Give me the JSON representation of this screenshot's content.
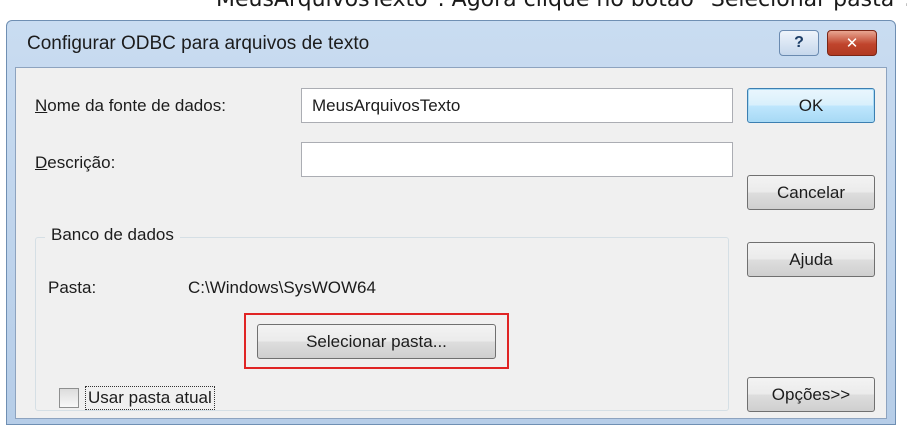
{
  "caption": {
    "text": "MeusArquivosTexto\". Agora clique no botão \"Selecionar pasta\"."
  },
  "window": {
    "title": "Configurar ODBC para arquivos de texto",
    "help_glyph": "?",
    "close_glyph": "✕"
  },
  "form": {
    "dsn_label": "Nome da fonte de dados:",
    "dsn_value": "MeusArquivosTexto",
    "desc_label": "Descrição:",
    "desc_value": ""
  },
  "database": {
    "group_title": "Banco de dados",
    "folder_label": "Pasta:",
    "folder_value": "C:\\Windows\\SysWOW64",
    "select_button": "Selecionar pasta...",
    "use_current_label": "Usar pasta atual",
    "use_current_checked": false
  },
  "buttons": {
    "ok": "OK",
    "cancel": "Cancelar",
    "help": "Ajuda",
    "options": "Opções>>"
  },
  "colors": {
    "highlight": "#e02424",
    "titlebar": "#c9dcf1",
    "close_button": "#c0442c",
    "default_button": "#a7d9f5"
  }
}
